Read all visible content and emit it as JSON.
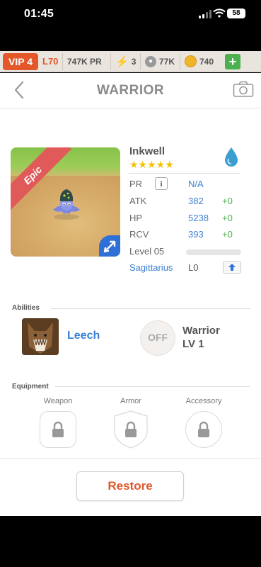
{
  "status_bar": {
    "time": "01:45",
    "battery": "58"
  },
  "resources": {
    "vip": "VIP 4",
    "level": "L70",
    "pr": "747K PR",
    "energy": "3",
    "paw": "77K",
    "coins": "740",
    "add_label": "+"
  },
  "header": {
    "title": "WARRIOR"
  },
  "pet": {
    "rarity": "Epic",
    "name": "Inkwell",
    "stars": "★★★★★",
    "stats": [
      {
        "label": "PR",
        "value": "N/A",
        "bonus": ""
      },
      {
        "label": "ATK",
        "value": "382",
        "bonus": "+0"
      },
      {
        "label": "HP",
        "value": "5238",
        "bonus": "+0"
      },
      {
        "label": "RCV",
        "value": "393",
        "bonus": "+0"
      }
    ],
    "level_label": "Level 05",
    "level_progress": 0,
    "sign": "Sagittarius",
    "sign_level": "L0",
    "info_label": "i"
  },
  "abilities": {
    "title": "Abilities",
    "ability_name": "Leech",
    "class_badge": "OFF",
    "class_name": "Warrior",
    "class_level": "LV 1"
  },
  "equipment": {
    "title": "Equipment",
    "slots": [
      "Weapon",
      "Armor",
      "Accessory"
    ]
  },
  "restore_label": "Restore",
  "colors": {
    "accent": "#e3572a",
    "blue": "#3b7fd4",
    "green": "#4caf50",
    "star": "#f2c200"
  }
}
